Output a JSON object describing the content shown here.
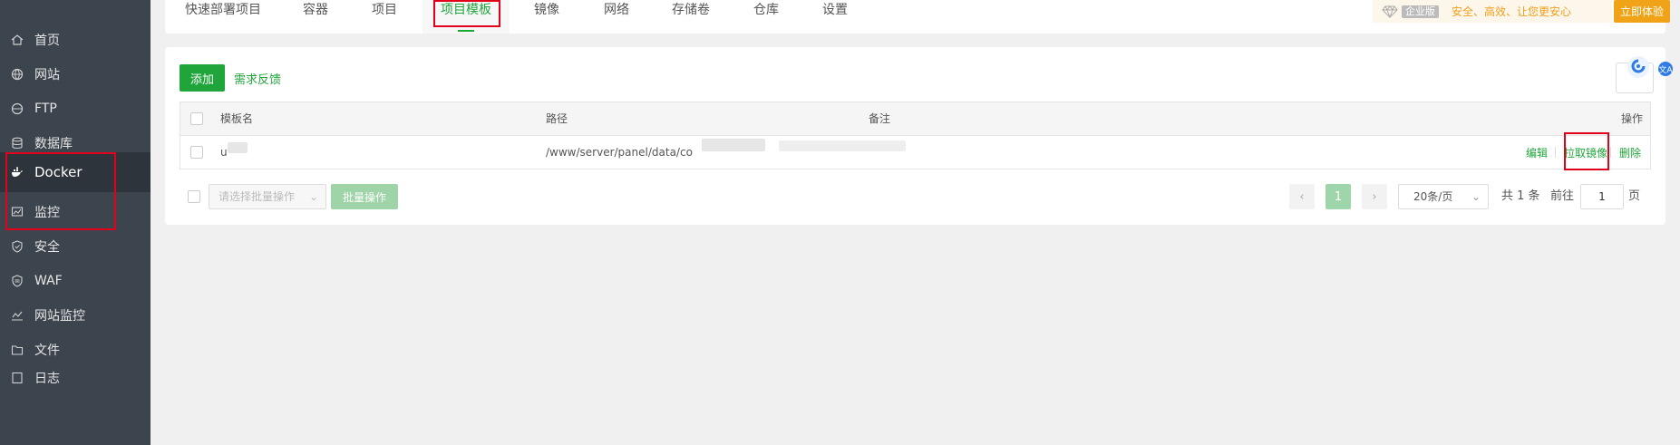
{
  "sidebar": {
    "items": [
      {
        "label": "首页",
        "icon": "home-icon"
      },
      {
        "label": "网站",
        "icon": "globe-icon"
      },
      {
        "label": "FTP",
        "icon": "ftp-icon"
      },
      {
        "label": "数据库",
        "icon": "database-icon"
      },
      {
        "label": "Docker",
        "icon": "docker-icon"
      },
      {
        "label": "监控",
        "icon": "monitor-icon"
      },
      {
        "label": "安全",
        "icon": "shield-icon"
      },
      {
        "label": "WAF",
        "icon": "waf-icon"
      },
      {
        "label": "网站监控",
        "icon": "site-monitor-icon"
      },
      {
        "label": "文件",
        "icon": "folder-icon"
      },
      {
        "label": "日志",
        "icon": "log-icon"
      }
    ]
  },
  "tabs": [
    {
      "label": "快速部署项目"
    },
    {
      "label": "容器"
    },
    {
      "label": "项目"
    },
    {
      "label": "项目模板"
    },
    {
      "label": "镜像"
    },
    {
      "label": "网络"
    },
    {
      "label": "存储卷"
    },
    {
      "label": "仓库"
    },
    {
      "label": "设置"
    }
  ],
  "promo": {
    "badge": "企业版",
    "slogan": "安全、高效、让您更安心",
    "button": "立即体验",
    "gem_icon": "diamond-icon"
  },
  "toolbar": {
    "add_label": "添加",
    "feedback_label": "需求反馈"
  },
  "table": {
    "headers": {
      "name": "模板名",
      "path": "路径",
      "remark": "备注",
      "action": "操作"
    },
    "rows": [
      {
        "name": "u",
        "path": "/www/server/panel/data/co",
        "remark": "",
        "actions": [
          "编辑",
          "拉取镜像",
          "删除"
        ]
      }
    ]
  },
  "footer": {
    "batch_placeholder": "请选择批量操作",
    "batch_button": "批量操作",
    "page": "1",
    "page_size": "20条/页",
    "total": "共 1 条",
    "goto_prefix": "前往",
    "goto_value": "1",
    "goto_suffix": "页"
  },
  "colors": {
    "accent": "#20a53a",
    "sidebar_bg": "#3c444d",
    "highlight": "#e3001b",
    "promo": "#f0a316"
  }
}
